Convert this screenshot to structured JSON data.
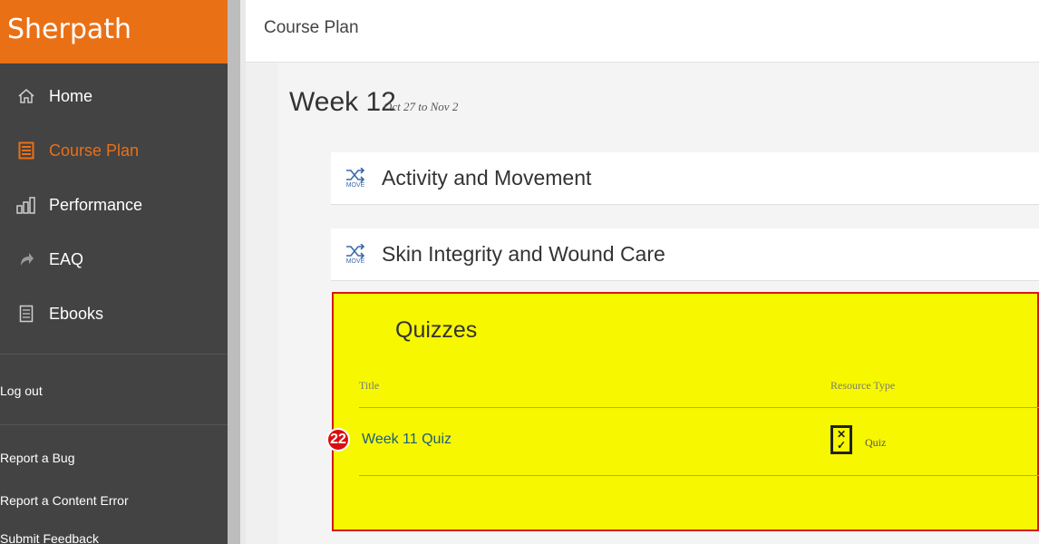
{
  "sidebar": {
    "brand": "Sherpath",
    "nav": [
      {
        "label": "Home",
        "icon": "home-icon"
      },
      {
        "label": "Course Plan",
        "icon": "list-icon"
      },
      {
        "label": "Performance",
        "icon": "bar-chart-icon"
      },
      {
        "label": "EAQ",
        "icon": "arrow-icon"
      },
      {
        "label": "Ebooks",
        "icon": "book-icon"
      }
    ],
    "logout": "Log out",
    "links": [
      "Report a Bug",
      "Report a Content Error",
      "Submit Feedback"
    ]
  },
  "header": {
    "title": "Course Plan"
  },
  "week": {
    "title": "Week 12",
    "dates": "Oct 27 to Nov 2"
  },
  "modules": [
    {
      "label": "Activity and Movement",
      "icon_caption": "MOVE"
    },
    {
      "label": "Skin Integrity and Wound Care",
      "icon_caption": "MOVE"
    }
  ],
  "quizzes": {
    "heading": "Quizzes",
    "columns": {
      "title": "Title",
      "type": "Resource Type"
    },
    "rows": [
      {
        "badge": "22",
        "title": "Week 11 Quiz",
        "type": "Quiz"
      }
    ]
  },
  "colors": {
    "brand": "#ea7016",
    "highlight": "#f7f700",
    "outline": "#d11a1a"
  }
}
